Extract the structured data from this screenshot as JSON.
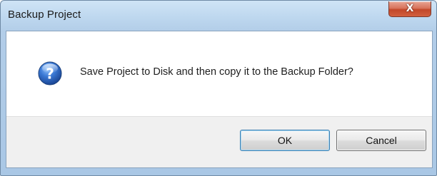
{
  "window": {
    "title": "Backup Project",
    "close_glyph": "X",
    "close_icon": "close-icon"
  },
  "dialog": {
    "icon": "question-icon",
    "message": "Save Project to Disk and then copy it to the Backup Folder?"
  },
  "buttons": {
    "ok_label": "OK",
    "cancel_label": "Cancel"
  },
  "colors": {
    "titlebar": "#bcd6ee",
    "close_button": "#c94a2e",
    "icon_blue": "#2c62b8",
    "button_bar": "#f0f0f0"
  }
}
